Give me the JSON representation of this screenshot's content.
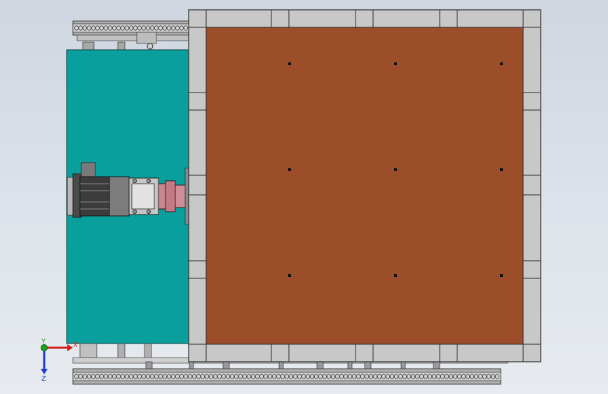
{
  "viewport": {
    "background_top": "#cfd6df",
    "background_bottom": "#e7ebf0"
  },
  "model": {
    "plate_color": "#9c4d29",
    "frame_color": "#c8c8c8",
    "housing_color": "#089f9c",
    "chain_color": "#9a9a9a",
    "motor_color": "#3c3c3c",
    "coupling_color": "#c6868e",
    "hole_count": 9
  },
  "triad": {
    "x_label": "X",
    "y_label": "Y",
    "z_label": "Z",
    "x_color": "#d41e1e",
    "y_color": "#1ea11e",
    "z_color": "#1e3ec8"
  }
}
